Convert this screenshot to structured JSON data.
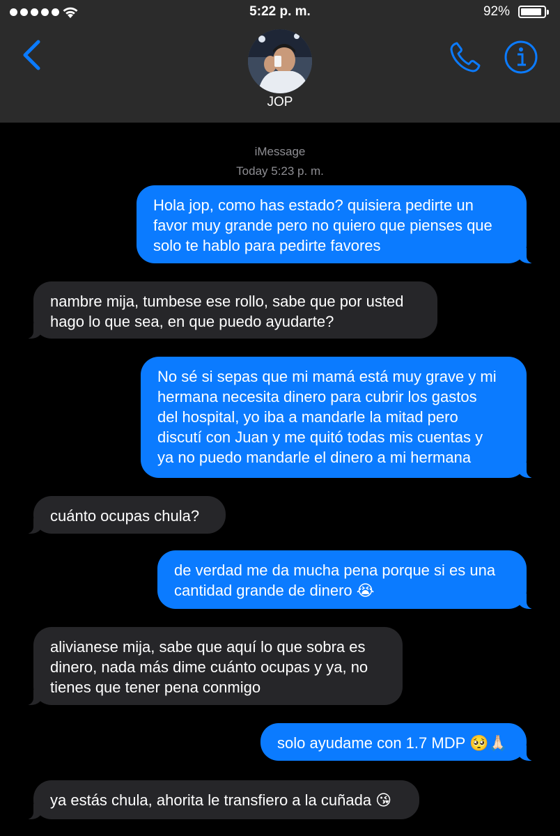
{
  "status_bar": {
    "time": "5:22 p. m.",
    "battery_percent": "92%",
    "battery_level": 0.92,
    "signal_dots": 5,
    "icons": [
      "signal-icon",
      "wifi-icon",
      "battery-icon"
    ]
  },
  "header": {
    "contact_name": "JOP",
    "icons": [
      "back-chevron-icon",
      "phone-icon",
      "info-icon"
    ],
    "accent_color": "#0b7bff"
  },
  "conversation": {
    "service": "iMessage",
    "timestamp": "Today 5:23 p. m.",
    "messages": [
      {
        "direction": "outgoing",
        "text": "Hola jop, como has estado? quisiera pedirte un\nfavor muy grande pero no quiero que pienses que\nsolo te hablo para pedirte favores"
      },
      {
        "direction": "incoming",
        "text": "nambre mija, tumbese ese rollo, sabe que por usted\nhago lo que sea, en que puedo ayudarte?"
      },
      {
        "direction": "outgoing",
        "text": "No sé si sepas que mi mamá está muy grave y mi\nhermana necesita dinero para cubrir los gastos\ndel hospital, yo iba a mandarle la mitad pero\ndiscutí con Juan y me quitó todas mis cuentas y\nya no puedo mandarle el dinero a mi hermana"
      },
      {
        "direction": "incoming",
        "text": "cuánto ocupas chula?"
      },
      {
        "direction": "outgoing",
        "text": "de verdad me da mucha pena porque si es una\ncantidad grande de dinero 😭"
      },
      {
        "direction": "incoming",
        "text": "alivianese mija, sabe que aquí lo que sobra es\ndinero, nada más dime cuánto ocupas y ya, no\ntienes que tener pena conmigo"
      },
      {
        "direction": "outgoing",
        "text": "solo ayudame con 1.7 MDP 🥺🙏🏻"
      },
      {
        "direction": "incoming",
        "text": "ya estás chula, ahorita le transfiero a la cuñada 😘"
      }
    ],
    "colors": {
      "outgoing": "#0b7bff",
      "incoming": "#262629",
      "background": "#000000"
    }
  }
}
